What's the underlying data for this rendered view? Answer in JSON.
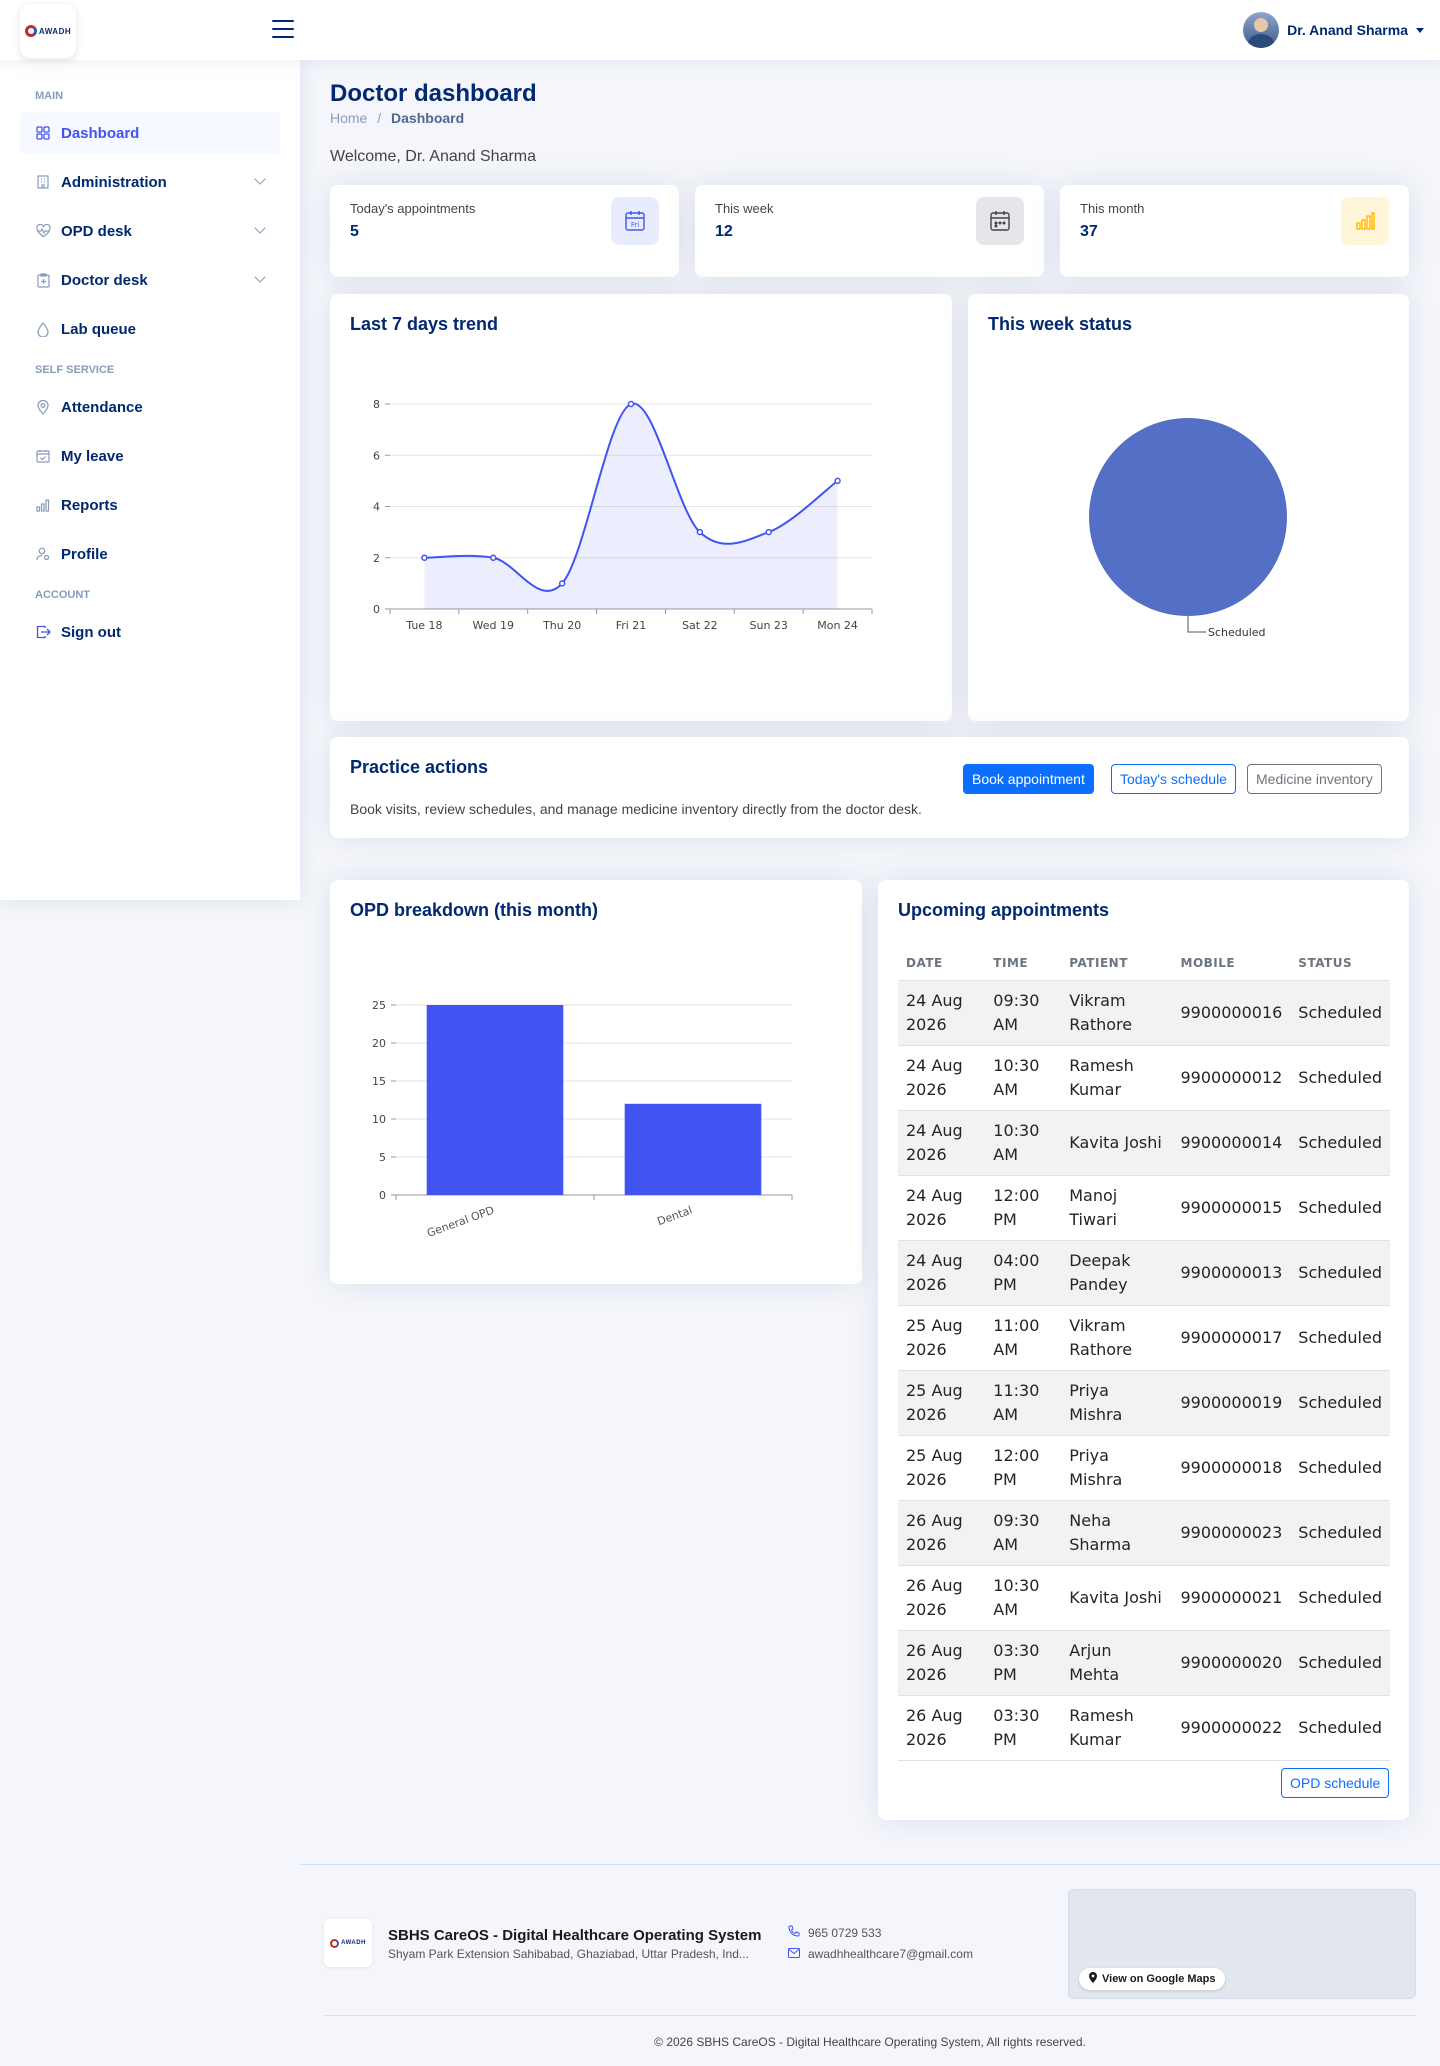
{
  "app": {
    "logo_text": "AWADH"
  },
  "header": {
    "user_name": "Dr. Anand Sharma"
  },
  "sidebar": {
    "headings": {
      "main": "MAIN",
      "self_service": "SELF SERVICE",
      "account": "ACCOUNT"
    },
    "items": [
      {
        "label": "Dashboard",
        "icon": "grid-icon"
      },
      {
        "label": "Administration",
        "icon": "building-icon"
      },
      {
        "label": "OPD desk",
        "icon": "heart-pulse-icon"
      },
      {
        "label": "Doctor desk",
        "icon": "clipboard-icon"
      },
      {
        "label": "Lab queue",
        "icon": "droplet-icon"
      },
      {
        "label": "Attendance",
        "icon": "pin-icon"
      },
      {
        "label": "My leave",
        "icon": "calendar-check-icon"
      },
      {
        "label": "Reports",
        "icon": "bar-chart-icon"
      },
      {
        "label": "Profile",
        "icon": "person-icon"
      },
      {
        "label": "Sign out",
        "icon": "sign-out-icon"
      }
    ]
  },
  "page": {
    "title": "Doctor dashboard",
    "breadcrumb": {
      "home": "Home",
      "separator": "/",
      "current": "Dashboard"
    },
    "welcome": "Welcome, Dr. Anand Sharma"
  },
  "stats": [
    {
      "label": "Today's appointments",
      "value": "5",
      "icon": "calendar-day-icon",
      "icon_text": "Fri",
      "color": "#4154f1"
    },
    {
      "label": "This week",
      "value": "12",
      "icon": "calendar-week-icon",
      "color": "#444444"
    },
    {
      "label": "This month",
      "value": "37",
      "icon": "bar-chart-icon",
      "color": "#ffbb00"
    }
  ],
  "trend_card": {
    "title": "Last 7 days trend"
  },
  "status_card": {
    "title": "This week status"
  },
  "practice": {
    "title": "Practice actions",
    "description": "Book visits, review schedules, and manage medicine inventory directly from the doctor desk.",
    "buttons": {
      "book": "Book appointment",
      "schedule": "Today's schedule",
      "inventory": "Medicine inventory"
    }
  },
  "opd_card": {
    "title": "OPD breakdown (this month)"
  },
  "appointments": {
    "title": "Upcoming appointments",
    "columns": [
      "DATE",
      "TIME",
      "PATIENT",
      "MOBILE",
      "STATUS"
    ],
    "rows": [
      [
        "24 Aug 2026",
        "09:30 AM",
        "Vikram Rathore",
        "9900000016",
        "Scheduled"
      ],
      [
        "24 Aug 2026",
        "10:30 AM",
        "Ramesh Kumar",
        "9900000012",
        "Scheduled"
      ],
      [
        "24 Aug 2026",
        "10:30 AM",
        "Kavita Joshi",
        "9900000014",
        "Scheduled"
      ],
      [
        "24 Aug 2026",
        "12:00 PM",
        "Manoj Tiwari",
        "9900000015",
        "Scheduled"
      ],
      [
        "24 Aug 2026",
        "04:00 PM",
        "Deepak Pandey",
        "9900000013",
        "Scheduled"
      ],
      [
        "25 Aug 2026",
        "11:00 AM",
        "Vikram Rathore",
        "9900000017",
        "Scheduled"
      ],
      [
        "25 Aug 2026",
        "11:30 AM",
        "Priya Mishra",
        "9900000019",
        "Scheduled"
      ],
      [
        "25 Aug 2026",
        "12:00 PM",
        "Priya Mishra",
        "9900000018",
        "Scheduled"
      ],
      [
        "26 Aug 2026",
        "09:30 AM",
        "Neha Sharma",
        "9900000023",
        "Scheduled"
      ],
      [
        "26 Aug 2026",
        "10:30 AM",
        "Kavita Joshi",
        "9900000021",
        "Scheduled"
      ],
      [
        "26 Aug 2026",
        "03:30 PM",
        "Arjun Mehta",
        "9900000020",
        "Scheduled"
      ],
      [
        "26 Aug 2026",
        "03:30 PM",
        "Ramesh Kumar",
        "9900000022",
        "Scheduled"
      ]
    ],
    "button": "OPD schedule"
  },
  "footer": {
    "name": "SBHS CareOS - Digital Healthcare Operating System",
    "address": "Shyam Park Extension Sahibabad, Ghaziabad, Uttar Pradesh, Ind...",
    "phone": "965 0729 533",
    "email": "awadhhealthcare7@gmail.com",
    "map_button": "View on Google Maps",
    "copyright": "© 2026 SBHS CareOS - Digital Healthcare Operating System, All rights reserved."
  },
  "chart_data": [
    {
      "type": "line",
      "categories": [
        "Tue 18",
        "Wed 19",
        "Thu 20",
        "Fri 21",
        "Sat 22",
        "Sun 23",
        "Mon 24"
      ],
      "values": [
        2,
        2,
        1,
        8,
        3,
        3,
        5
      ],
      "ylim": [
        0,
        8
      ],
      "yticks": [
        0,
        2,
        4,
        6,
        8
      ],
      "color": "#4154f1",
      "area": true,
      "grid": true
    },
    {
      "type": "pie",
      "categories": [
        "Scheduled"
      ],
      "values": [
        1
      ],
      "color": "#5470c6",
      "labels": [
        "Scheduled"
      ]
    },
    {
      "type": "bar",
      "categories": [
        "General OPD",
        "Dental"
      ],
      "values": [
        25,
        12
      ],
      "ylim": [
        0,
        25
      ],
      "yticks": [
        0,
        5,
        10,
        15,
        20,
        25
      ],
      "color": "#4154f1",
      "grid": true
    }
  ]
}
